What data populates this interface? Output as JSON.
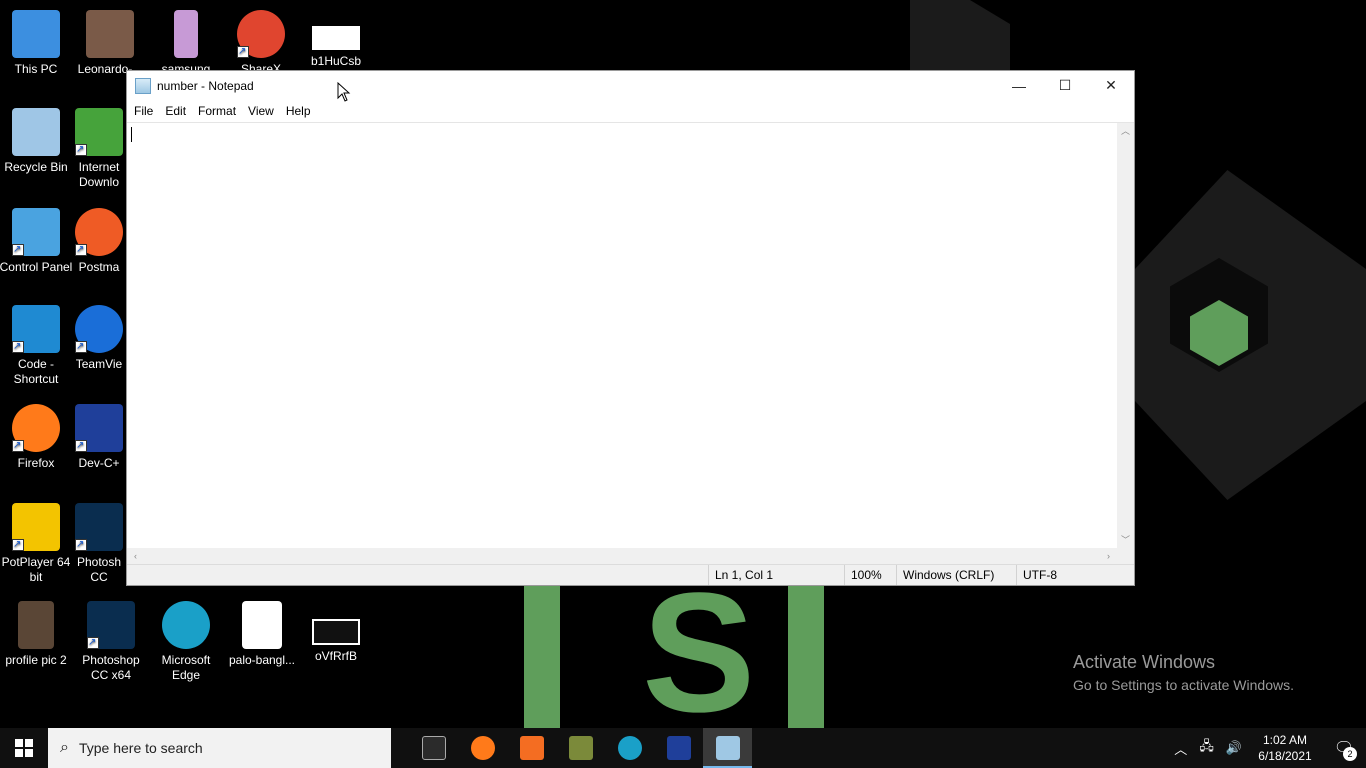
{
  "desktop": {
    "icons": [
      {
        "label": "This PC",
        "color": "#3c8fe0"
      },
      {
        "label": "Leonardo-...",
        "color": "#7a5a48"
      },
      {
        "label": "samsung",
        "color": "#c79ad6"
      },
      {
        "label": "ShareX",
        "color": "#e0452f"
      },
      {
        "label": "b1HuCsb",
        "color": "#ffffff"
      },
      {
        "label": "Recycle Bin",
        "color": "#9fc6e6"
      },
      {
        "label": "Internet Downlo",
        "color": "#46a33b"
      },
      {
        "label": "Control Panel",
        "color": "#4aa3e0"
      },
      {
        "label": "Postma",
        "color": "#ef5b25"
      },
      {
        "label": "Code - Shortcut",
        "color": "#1f8ad2"
      },
      {
        "label": "TeamVie",
        "color": "#1a6ed8"
      },
      {
        "label": "Firefox",
        "color": "#ff7a1a"
      },
      {
        "label": "Dev-C+",
        "color": "#1f3f9a"
      },
      {
        "label": "PotPlayer 64 bit",
        "color": "#f3c400"
      },
      {
        "label": "Photosh CC",
        "color": "#0a2d4f"
      },
      {
        "label": "profile pic 2",
        "color": "#5a4636"
      },
      {
        "label": "Photoshop CC x64",
        "color": "#0a2d4f"
      },
      {
        "label": "Microsoft Edge",
        "color": "#1aa0c8"
      },
      {
        "label": "palo-bangl...",
        "color": "#ffffff"
      },
      {
        "label": "oVfRrfB",
        "color": "#ffffff"
      }
    ]
  },
  "notepad": {
    "title": "number - Notepad",
    "menu": [
      "File",
      "Edit",
      "Format",
      "View",
      "Help"
    ],
    "minimize": "—",
    "maximize": "☐",
    "close": "✕",
    "status": {
      "position": "Ln 1, Col 1",
      "zoom": "100%",
      "line_endings": "Windows (CRLF)",
      "encoding": "UTF-8"
    }
  },
  "activation": {
    "line1": "Activate Windows",
    "line2": "Go to Settings to activate Windows."
  },
  "taskbar": {
    "search_placeholder": "Type here to search",
    "apps": [
      {
        "name": "terminal",
        "color": "#2b2b2b"
      },
      {
        "name": "firefox",
        "color": "#ff7a1a"
      },
      {
        "name": "xampp",
        "color": "#f46d22"
      },
      {
        "name": "git",
        "color": "#7b8a3a"
      },
      {
        "name": "edge",
        "color": "#1aa0c8"
      },
      {
        "name": "dev-cpp",
        "color": "#1f3f9a"
      },
      {
        "name": "notepad",
        "color": "#9fc8e4"
      }
    ],
    "time": "1:02 AM",
    "date": "6/18/2021",
    "notifications": "2"
  }
}
